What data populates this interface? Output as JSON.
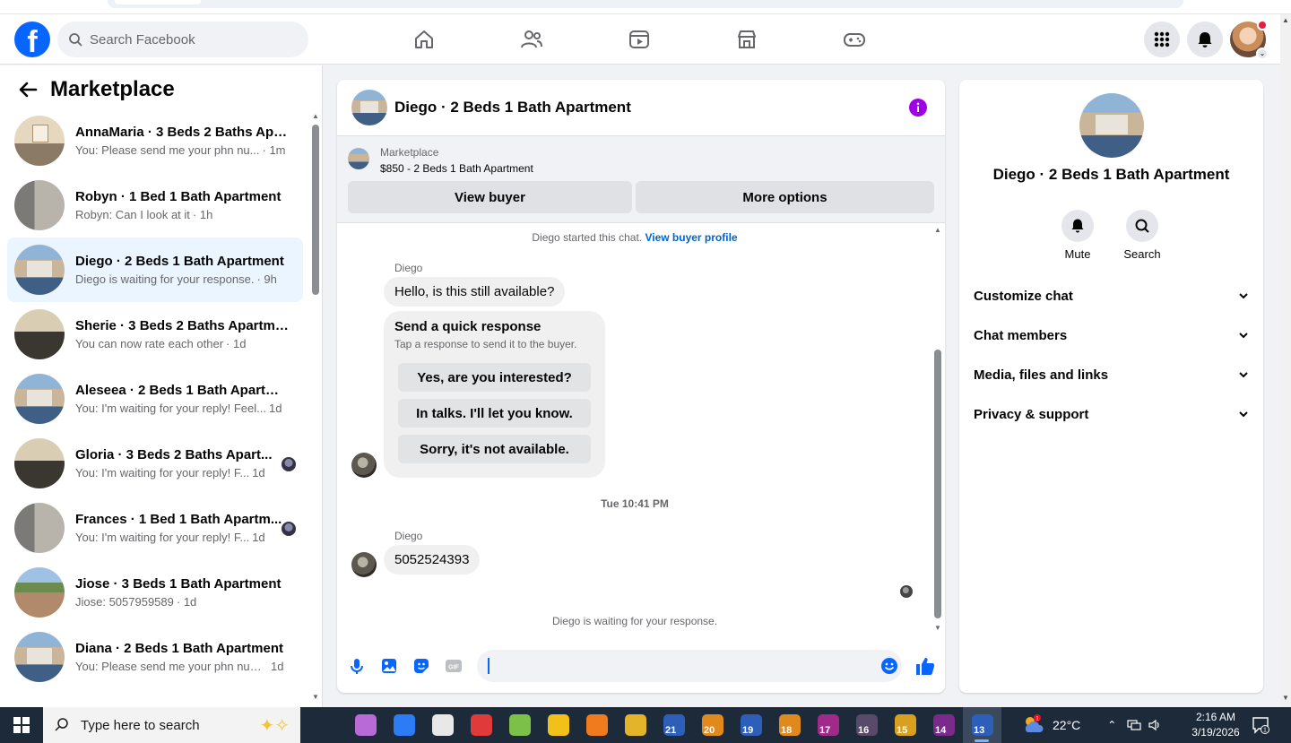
{
  "colors": {
    "brand": "#0866ff",
    "link": "#0064d1",
    "active_row": "#ebf5ff"
  },
  "topnav": {
    "logo": "f",
    "search_placeholder": "Search Facebook",
    "nav_icons": [
      "home-icon",
      "friends-icon",
      "video-icon",
      "marketplace-icon",
      "gaming-icon"
    ],
    "right_icons": [
      "menu-grid-icon",
      "notifications-icon",
      "profile-avatar"
    ]
  },
  "sidebar": {
    "title": "Marketplace",
    "conversations": [
      {
        "name": "AnnaMaria · 3 Beds 2 Baths Apa...",
        "message": "You: Please send me your phn nu...",
        "time": "· 1m",
        "thumb": "room"
      },
      {
        "name": "Robyn · 1 Bed 1 Bath Apartment",
        "message": "Robyn: Can I look at it",
        "time": "· 1h",
        "thumb": "bath"
      },
      {
        "name": "Diego · 2 Beds 1 Bath Apartment",
        "message": "Diego is waiting for your response.",
        "time": "· 9h",
        "thumb": "garage",
        "active": true
      },
      {
        "name": "Sherie · 3 Beds 2 Baths Apartment",
        "message": "You can now rate each other",
        "time": "· 1d",
        "thumb": "dark"
      },
      {
        "name": "Aleseea · 2 Beds 1 Bath Apartment",
        "message": "You: I'm waiting for your reply! Feel...",
        "time": "1d",
        "thumb": "garage"
      },
      {
        "name": "Gloria · 3 Beds 2 Baths Apart...",
        "message": "You: I'm waiting for your reply! F...",
        "time": "1d",
        "thumb": "dark",
        "seen": true
      },
      {
        "name": "Frances · 1 Bed 1 Bath Apartm...",
        "message": "You: I'm waiting for your reply! F...",
        "time": "1d",
        "thumb": "bath",
        "seen": true
      },
      {
        "name": "Jiose · 3 Beds 1 Bath Apartment",
        "message": "Jiose: 5057959589",
        "time": "· 1d",
        "thumb": "yard"
      },
      {
        "name": "Diana · 2 Beds 1 Bath Apartment",
        "message": "You: Please send me your phn num...",
        "time": "1d",
        "thumb": "garage"
      }
    ]
  },
  "chat": {
    "title": "Diego · 2 Beds 1 Bath Apartment",
    "listing_label": "Marketplace",
    "listing_price": "$850 - 2 Beds 1 Bath Apartment",
    "view_buyer": "View buyer",
    "more_options": "More options",
    "started_text": "Diego started this chat.",
    "started_link": "View buyer profile",
    "sender1": "Diego",
    "message1": "Hello, is this still available?",
    "quick_title": "Send a quick response",
    "quick_sub": "Tap a response to send it to the buyer.",
    "quick_replies": [
      "Yes, are you interested?",
      "In talks. I'll let you know.",
      "Sorry, it's not available."
    ],
    "timestamp": "Tue 10:41 PM",
    "sender2": "Diego",
    "message2": "5052524393",
    "waiting": "Diego is waiting for your response.",
    "composer_icons": [
      "microphone-icon",
      "photo-icon",
      "sticker-icon",
      "gif-icon",
      "emoji-icon",
      "thumbs-up-icon"
    ],
    "composer_value": ""
  },
  "rpanel": {
    "title": "Diego · 2 Beds 1 Bath Apartment",
    "mute": "Mute",
    "search": "Search",
    "sections": [
      "Customize chat",
      "Chat members",
      "Media, files and links",
      "Privacy & support"
    ]
  },
  "taskbar": {
    "search_placeholder": "Type here to search",
    "apps": [
      {
        "name": "task-view",
        "color": "#1c2a3a",
        "num": ""
      },
      {
        "name": "copilot",
        "color": "#b86ad6",
        "num": ""
      },
      {
        "name": "maps",
        "color": "#2d7cf6",
        "num": ""
      },
      {
        "name": "paint",
        "color": "#e8e8e8",
        "num": ""
      },
      {
        "name": "stack",
        "color": "#e03a3a",
        "num": ""
      },
      {
        "name": "notepad",
        "color": "#7cc04a",
        "num": ""
      },
      {
        "name": "chrome",
        "color": "#f2c01a",
        "num": ""
      },
      {
        "name": "firefox",
        "color": "#f07a1e",
        "num": ""
      },
      {
        "name": "app-x",
        "color": "#e3b429",
        "num": ""
      },
      {
        "name": "win-21",
        "color": "#2d5fb8",
        "num": "21"
      },
      {
        "name": "win-20",
        "color": "#e08a1e",
        "num": "20"
      },
      {
        "name": "win-19",
        "color": "#2d5fb8",
        "num": "19"
      },
      {
        "name": "win-18",
        "color": "#e08a1e",
        "num": "18"
      },
      {
        "name": "win-17",
        "color": "#a02a8a",
        "num": "17"
      },
      {
        "name": "win-16",
        "color": "#5a4a6a",
        "num": "16"
      },
      {
        "name": "win-15",
        "color": "#d8a020",
        "num": "15"
      },
      {
        "name": "win-14",
        "color": "#7a2a8a",
        "num": "14"
      },
      {
        "name": "win-13",
        "color": "#2d5fb8",
        "num": "13",
        "active": true
      }
    ],
    "temperature": "22°C",
    "time": "2:16 AM",
    "date": "3/19/2026"
  }
}
